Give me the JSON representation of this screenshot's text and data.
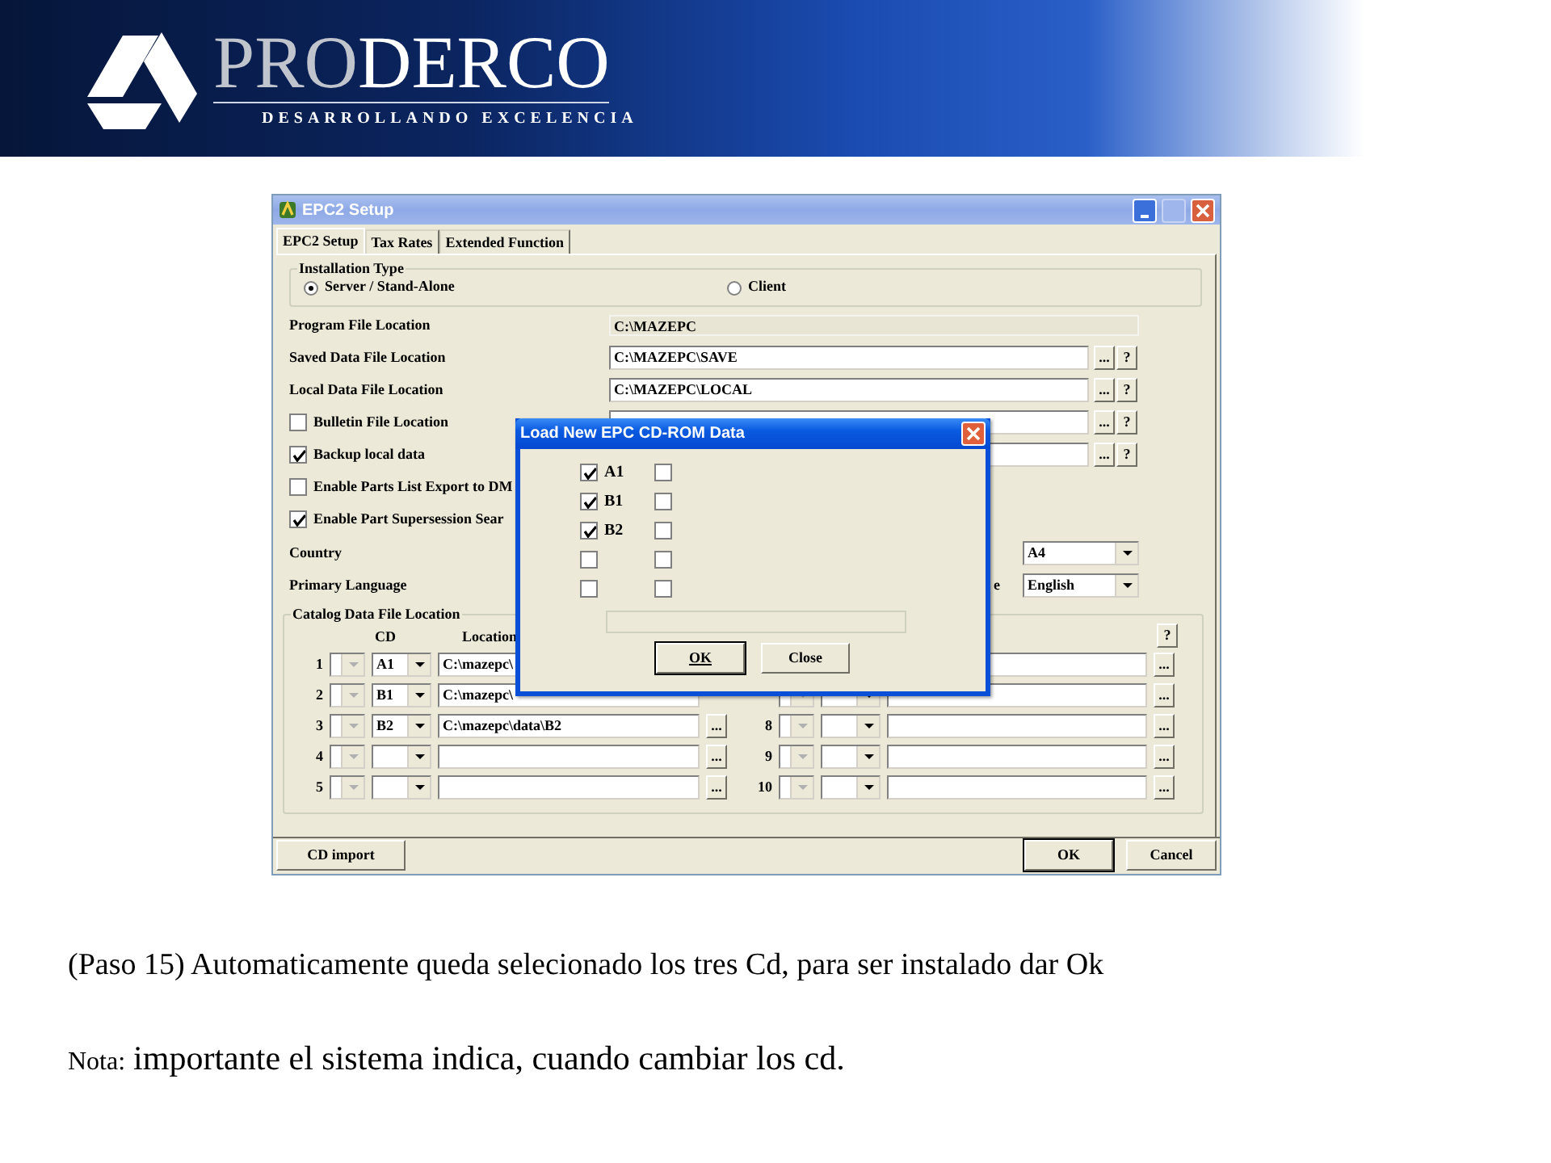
{
  "banner": {
    "brand_light": "PRO",
    "brand_bold": "DERCO",
    "tagline": "DESARROLLANDO EXCELENCIA"
  },
  "window": {
    "title": "EPC2 Setup",
    "tabs": [
      {
        "label": "EPC2 Setup",
        "selected": true
      },
      {
        "label": "Tax Rates",
        "selected": false
      },
      {
        "label": "Extended Function",
        "selected": false
      }
    ],
    "installation_type": {
      "legend": "Installation Type",
      "options": [
        {
          "label": "Server / Stand-Alone",
          "selected": true
        },
        {
          "label": "Client",
          "selected": false
        }
      ]
    },
    "locations": [
      {
        "kind": "readonly",
        "label": "Program File Location",
        "value": "C:\\MAZEPC"
      },
      {
        "kind": "field",
        "label": "Saved Data File Location",
        "value": "C:\\MAZEPC\\SAVE",
        "browse": "...",
        "help": "?"
      },
      {
        "kind": "field",
        "label": "Local Data File Location",
        "value": "C:\\MAZEPC\\LOCAL",
        "browse": "...",
        "help": "?"
      },
      {
        "kind": "check_field",
        "label": "Bulletin File Location",
        "checked": false,
        "browse": "...",
        "help": "?"
      },
      {
        "kind": "check_field",
        "label": "Backup local data",
        "checked": true,
        "browse": "...",
        "help": "?"
      },
      {
        "kind": "check",
        "label": "Enable Parts List Export to DM",
        "checked": false
      },
      {
        "kind": "check",
        "label": "Enable Part Supersession Sear",
        "checked": true
      }
    ],
    "country": {
      "label": "Country",
      "value": "A4"
    },
    "language": {
      "label": "Primary Language",
      "right_label": "e",
      "value": "English"
    },
    "catalog": {
      "legend": "Catalog Data File Location",
      "col_cd": "CD",
      "col_location": "Location",
      "help": "?",
      "left_rows": [
        {
          "number": "1",
          "cd": "A1",
          "location": "C:\\mazepc\\"
        },
        {
          "number": "2",
          "cd": "B1",
          "location": "C:\\mazepc\\"
        },
        {
          "number": "3",
          "cd": "B2",
          "location": "C:\\mazepc\\data\\B2",
          "browse": "..."
        },
        {
          "number": "4",
          "browse": "..."
        },
        {
          "number": "5",
          "browse": "..."
        }
      ],
      "right_rows": [
        {
          "browse": "..."
        },
        {
          "browse": "..."
        },
        {
          "number": "8",
          "browse": "..."
        },
        {
          "number": "9",
          "browse": "..."
        },
        {
          "number": "10",
          "browse": "..."
        }
      ]
    },
    "bottom_buttons": {
      "left": "CD import",
      "ok": "OK",
      "cancel": "Cancel"
    },
    "dialog": {
      "title": "Load New EPC CD-ROM Data",
      "columns": [
        [
          {
            "label": "A1",
            "checked": true
          },
          {
            "label": "B1",
            "checked": true
          },
          {
            "label": "B2",
            "checked": true
          },
          {
            "checked": false
          },
          {
            "checked": false
          }
        ],
        [
          {
            "checked": false
          },
          {
            "checked": false
          },
          {
            "checked": false
          },
          {
            "checked": false
          },
          {
            "checked": false
          }
        ]
      ],
      "progress": {
        "level": 0
      },
      "ok": "OK",
      "close": "Close"
    }
  },
  "caption": "(Paso 15) Automaticamente queda selecionado los tres Cd, para ser instalado dar Ok",
  "note": {
    "label": "Nota:",
    "text": "importante el sistema indica, cuando cambiar los cd."
  }
}
